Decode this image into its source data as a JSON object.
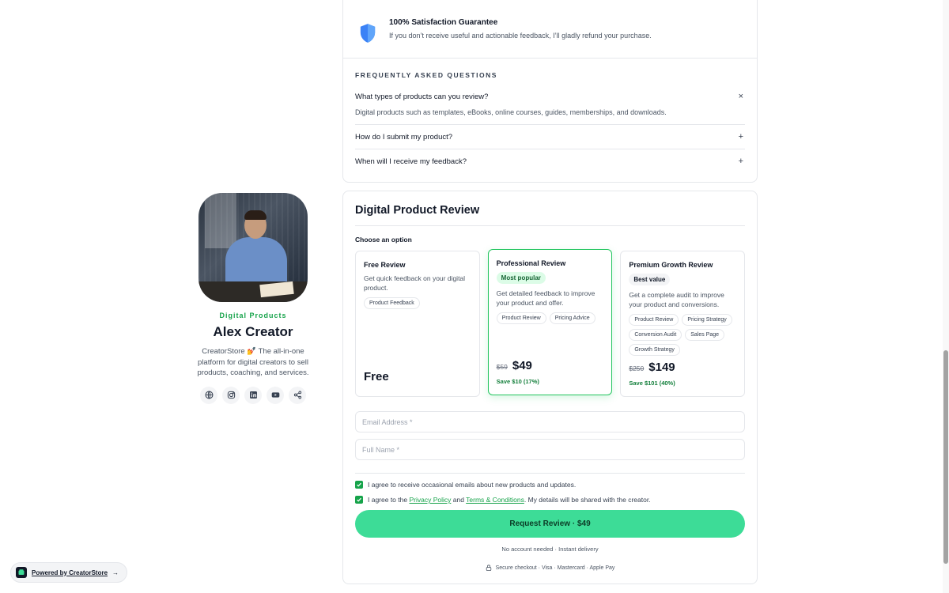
{
  "guarantee": {
    "title": "100% Satisfaction Guarantee",
    "text": "If you don’t receive useful and actionable feedback, I’ll gladly refund your purchase."
  },
  "faq": {
    "heading": "FREQUENTLY ASKED QUESTIONS",
    "items": [
      {
        "question": "What types of products can you review?",
        "toggle": "×",
        "answer": "Digital products such as templates, eBooks, online courses, guides, memberships, and downloads."
      },
      {
        "question": "How do I submit my product?",
        "toggle": "+"
      },
      {
        "question": "When will I receive my feedback?",
        "toggle": "+"
      }
    ]
  },
  "profile": {
    "category": "Digital Products",
    "name": "Alex Creator",
    "bio": "CreatorStore 💅 The all-in-one platform for digital creators to sell products, coaching, and services.",
    "socials": [
      "globe-icon",
      "instagram-icon",
      "linkedin-icon",
      "youtube-icon",
      "share-icon"
    ]
  },
  "product": {
    "title": "Digital Product Review",
    "choose_label": "Choose an option",
    "options": [
      {
        "title": "Free Review",
        "description": "Get quick feedback on your digital product.",
        "tags": [
          "Product Feedback"
        ],
        "price": "Free"
      },
      {
        "title": "Professional Review",
        "badge": "Most popular",
        "description": "Get detailed feedback to improve your product and offer.",
        "tags": [
          "Product Review",
          "Pricing Advice"
        ],
        "old_price": "$59",
        "price": "$49",
        "save": "Save $10 (17%)",
        "selected": true
      },
      {
        "title": "Premium Growth Review",
        "badge": "Best value",
        "description": "Get a complete audit to improve your product and conversions.",
        "tags": [
          "Product Review",
          "Pricing Strategy",
          "Conversion Audit",
          "Sales Page",
          "Growth Strategy"
        ],
        "old_price": "$250",
        "price": "$149",
        "save": "Save $101 (40%)"
      }
    ]
  },
  "form": {
    "email_placeholder": "Email Address *",
    "name_placeholder": "Full Name *",
    "consent_emails": "I agree to receive occasional emails about new products and updates.",
    "consent_terms_prefix": "I agree to the",
    "privacy_link": "Privacy Policy",
    "and": "and",
    "terms_link": "Terms & Conditions",
    "consent_terms_suffix": ". My details will be shared with the creator.",
    "cta": "Request Review  · $49",
    "note": "No account needed · Instant delivery",
    "secure": "Secure checkout · Visa · Mastercard · Apple Pay"
  },
  "powered": {
    "label": "Powered by CreatorStore",
    "arrow": "→"
  },
  "colors": {
    "accent": "#3ddc97",
    "accent_dark": "#16a34a",
    "shield": "#3b82f6"
  }
}
